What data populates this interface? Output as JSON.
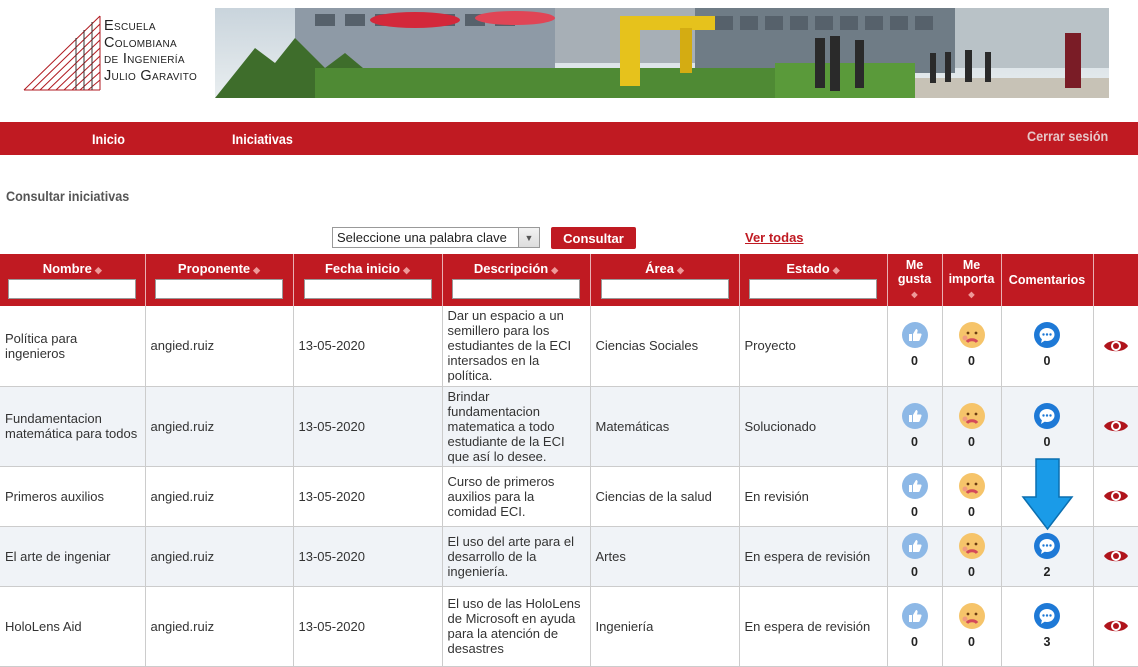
{
  "logo": {
    "lines": [
      "Escuela",
      "Colombiana",
      "de Ingeniería",
      "Julio Garavito"
    ]
  },
  "nav": {
    "inicio": "Inicio",
    "iniciativas": "Iniciativas",
    "logout": "Cerrar sesión"
  },
  "page": {
    "title": "Consultar iniciativas"
  },
  "search": {
    "keyword_selected": "Seleccione una palabra clave",
    "consultar_label": "Consultar",
    "ver_todas_label": "Ver todas"
  },
  "table": {
    "headers": {
      "nombre": "Nombre",
      "proponente": "Proponente",
      "fecha": "Fecha inicio",
      "descripcion": "Descripción",
      "area": "Área",
      "estado": "Estado",
      "me_gusta_1": "Me",
      "me_gusta_2": "gusta",
      "me_importa_1": "Me",
      "me_importa_2": "importa",
      "comentarios": "Comentarios"
    },
    "rows": [
      {
        "nombre": "Política para ingenieros",
        "proponente": "angied.ruiz",
        "fecha": "13-05-2020",
        "descripcion": "Dar un espacio a un semillero para los estudiantes de la ECI intersados en la política.",
        "area": "Ciencias Sociales",
        "estado": "Proyecto",
        "likes": "0",
        "importa": "0",
        "comentarios": "0"
      },
      {
        "nombre": "Fundamentacion matemática para todos",
        "proponente": "angied.ruiz",
        "fecha": "13-05-2020",
        "descripcion": "Brindar fundamentacion matematica a todo estudiante de la ECI que así lo desee.",
        "area": "Matemáticas",
        "estado": "Solucionado",
        "likes": "0",
        "importa": "0",
        "comentarios": "0"
      },
      {
        "nombre": "Primeros auxilios",
        "proponente": "angied.ruiz",
        "fecha": "13-05-2020",
        "descripcion": "Curso de primeros auxilios para la comidad ECI.",
        "area": "Ciencias de la salud",
        "estado": "En revisión",
        "likes": "0",
        "importa": "0",
        "comentarios": ""
      },
      {
        "nombre": "El arte de ingeniar",
        "proponente": "angied.ruiz",
        "fecha": "13-05-2020",
        "descripcion": "El uso del arte para el desarrollo de la ingeniería.",
        "area": "Artes",
        "estado": "En espera de revisión",
        "likes": "0",
        "importa": "0",
        "comentarios": "2"
      },
      {
        "nombre": "HoloLens Aid",
        "proponente": "angied.ruiz",
        "fecha": "13-05-2020",
        "descripcion": "El uso de las HoloLens de Microsoft en ayuda para la atención de desastres",
        "area": "Ingeniería",
        "estado": "En espera de revisión",
        "likes": "0",
        "importa": "0",
        "comentarios": "3"
      }
    ]
  },
  "colors": {
    "brand_red": "#c01a22",
    "like_blue": "#8db8e6",
    "comment_blue": "#1e79d6",
    "eye_red": "#b0141c",
    "annotation_arrow": "#1a9be8"
  }
}
